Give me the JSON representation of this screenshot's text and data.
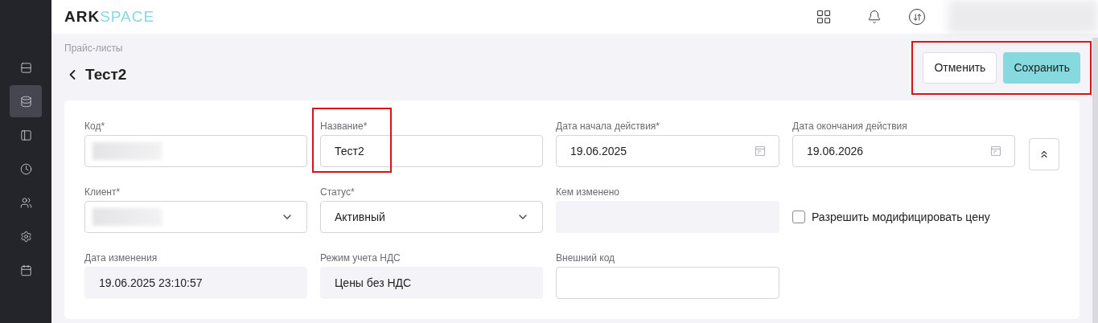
{
  "header": {
    "logo": {
      "part_1": "ARK",
      "part_2": "SPACE"
    },
    "user": {
      "redacted": true
    }
  },
  "sidebar": {
    "items": [
      {
        "selected": false
      },
      {
        "selected": true
      },
      {
        "selected": false
      },
      {
        "selected": false
      },
      {
        "selected": false
      },
      {
        "selected": false
      },
      {
        "selected": false
      }
    ]
  },
  "breadcrumb": "Прайс-листы",
  "title": "Тест2",
  "actions": {
    "highlighted": true,
    "buttons": [
      {
        "label": "Отменить",
        "kind": "secondary"
      },
      {
        "label": "Сохранить",
        "kind": "primary"
      }
    ]
  },
  "form": {
    "fields": [
      {
        "kind": "text",
        "label": "Код*",
        "redacted": true
      },
      {
        "kind": "text",
        "label": "Название*",
        "value": "Тест2",
        "highlighted": true
      },
      {
        "kind": "date",
        "label": "Дата начала действия*",
        "value": "19.06.2025"
      },
      {
        "kind": "date",
        "label": "Дата окончания действия",
        "value": "19.06.2026"
      },
      {
        "kind": "select",
        "label": "Клиент*",
        "redacted": true
      },
      {
        "kind": "select",
        "label": "Статус*",
        "value": "Активный"
      },
      {
        "kind": "readonly",
        "label": "Кем изменено"
      },
      {
        "kind": "checkbox",
        "label": "Разрешить модифицировать цену",
        "checked": false
      },
      {
        "kind": "readonly",
        "label": "Дата изменения",
        "value": "19.06.2025 23:10:57"
      },
      {
        "kind": "readonly",
        "label": "Режим учета НДС",
        "value": "Цены без НДС"
      },
      {
        "kind": "text",
        "label": "Внешний код"
      }
    ],
    "collapse_button": {
      "expanded": true
    }
  }
}
